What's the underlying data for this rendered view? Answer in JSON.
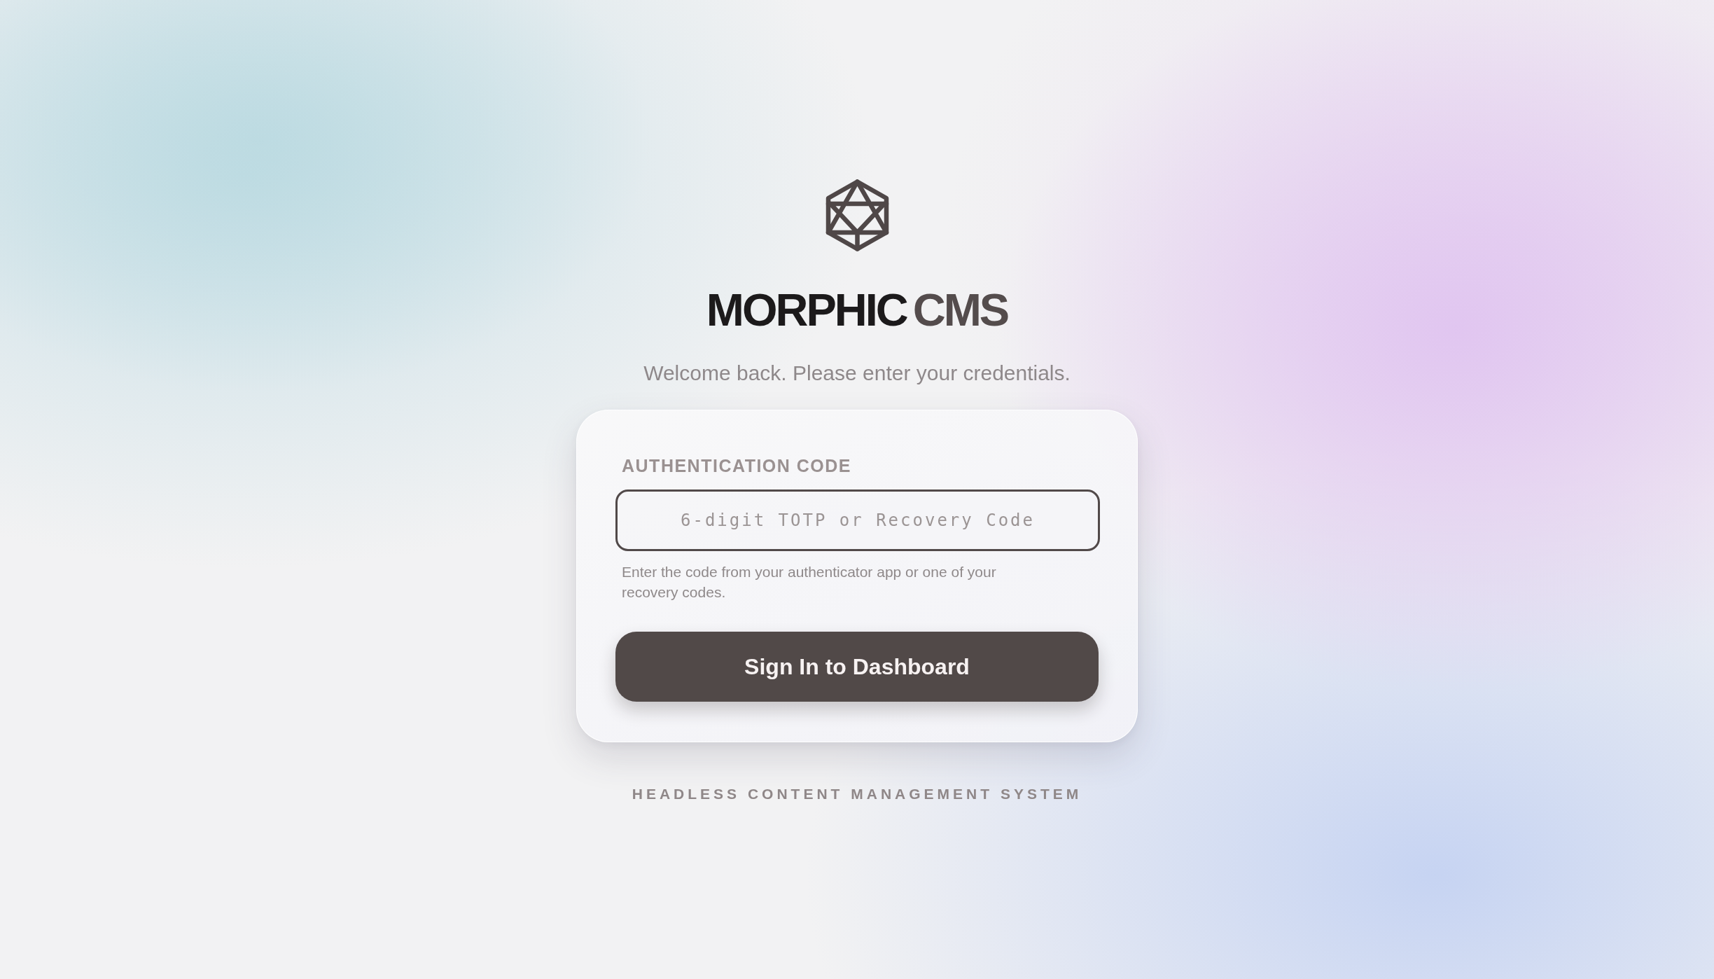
{
  "brand": {
    "name": "MORPHIC",
    "suffix": "CMS"
  },
  "subtitle": "Welcome back. Please enter your credentials.",
  "form": {
    "field": {
      "label": "AUTHENTICATION CODE",
      "placeholder": "6-digit TOTP or Recovery Code",
      "hint": "Enter the code from your authenticator app or one of your recovery codes."
    },
    "submit_button": "Sign In to Dashboard"
  },
  "footer": "HEADLESS CONTENT MANAGEMENT SYSTEM"
}
